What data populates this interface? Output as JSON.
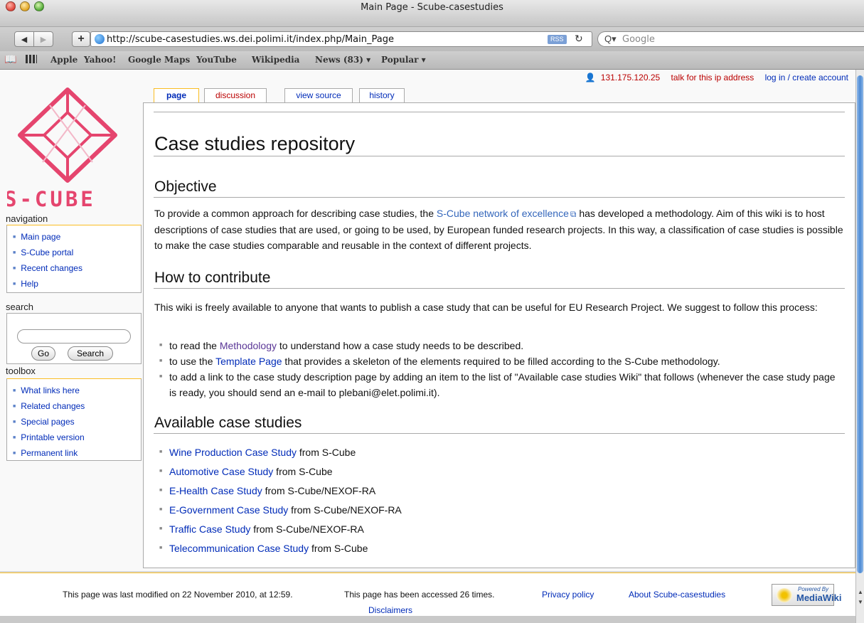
{
  "window": {
    "title": "Main Page - Scube-casestudies"
  },
  "toolbar": {
    "back_label": "◀",
    "forward_label": "▶",
    "add_label": "+",
    "url": "http://scube-casestudies.ws.dei.polimi.it/index.php/Main_Page",
    "rss_label": "RSS",
    "reload_label": "↻",
    "search_glass_label": "Q▾",
    "search_placeholder": "Google"
  },
  "bookmarks": {
    "book_icon": "📖",
    "items": [
      "Apple",
      "Yahoo!",
      "Google Maps",
      "YouTube",
      "Wikipedia",
      "News (83) ▾",
      "Popular ▾"
    ]
  },
  "userbar": {
    "person_icon": "👤",
    "ip": "131.175.120.25",
    "talk": "talk for this ip address",
    "login": "log in / create account"
  },
  "tabs": [
    "page",
    "discussion",
    "view source",
    "history"
  ],
  "logo": {
    "wordmark": "S-CUBE"
  },
  "navigation": {
    "title": "navigation",
    "items": [
      "Main page",
      "S-Cube portal",
      "Recent changes",
      "Help"
    ]
  },
  "search": {
    "title": "search",
    "go_label": "Go",
    "search_label": "Search"
  },
  "toolbox": {
    "title": "toolbox",
    "items": [
      "What links here",
      "Related changes",
      "Special pages",
      "Printable version",
      "Permanent link"
    ]
  },
  "content": {
    "title": "Case studies repository",
    "objective": {
      "heading": "Objective",
      "before": "To provide a common approach for describing case studies, the ",
      "link": "S-Cube network of excellence",
      "ext_icon": "⧉",
      "after": " has developed a methodology. Aim of this wiki is to host descriptions of case studies that are used, or going to be used, by European funded research projects. In this way, a classification of case studies is possible to make the case studies comparable and reusable in the context of different projects."
    },
    "contribute": {
      "heading": "How to contribute",
      "intro": "This wiki is freely available to anyone that wants to publish a case study that can be useful for EU Research Project. We suggest to follow this process:",
      "steps": [
        {
          "pre": "to read the ",
          "link": "Methodology",
          "post": " to understand how a case study needs to be described."
        },
        {
          "pre": "to use the ",
          "link": "Template Page",
          "post": " that provides a skeleton of the elements required to be filled according to the S-Cube methodology."
        },
        {
          "pre": "to add a link to the case study description page by adding an item to the list of \"Available case studies Wiki\" that follows (whenever the case study page is ready, you should send an e-mail to plebani@elet.polimi.it).",
          "link": "",
          "post": ""
        }
      ]
    },
    "available": {
      "heading": "Available case studies",
      "items": [
        {
          "link": "Wine Production Case Study",
          "from": " from S-Cube"
        },
        {
          "link": "Automotive Case Study",
          "from": " from S-Cube"
        },
        {
          "link": "E-Health Case Study",
          "from": " from S-Cube/NEXOF-RA"
        },
        {
          "link": "E-Government Case Study",
          "from": " from S-Cube/NEXOF-RA"
        },
        {
          "link": "Traffic Case Study",
          "from": " from S-Cube/NEXOF-RA"
        },
        {
          "link": "Telecommunication Case Study",
          "from": " from S-Cube"
        }
      ]
    }
  },
  "footer": {
    "modified": "This page was last modified on 22 November 2010, at 12:59.",
    "accessed": "This page has been accessed 26 times.",
    "privacy": "Privacy policy",
    "about": "About Scube-casestudies",
    "disclaimers": "Disclaimers",
    "badge_powered": "Powered By",
    "badge_name": "MediaWiki"
  },
  "colors": {
    "link": "#002bb8",
    "visited_link": "#5a3696",
    "new_link": "#ba0000",
    "tab_accent": "#fabd23",
    "logo_pink": "#e5456e"
  }
}
